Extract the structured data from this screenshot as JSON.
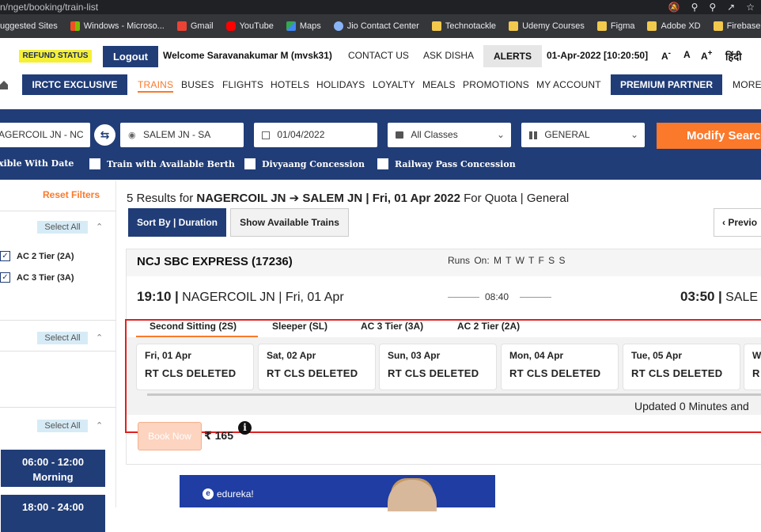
{
  "browser": {
    "url": "n/nget/booking/train-list",
    "bookmarks": [
      "uggested Sites",
      "Windows - Microso...",
      "Gmail",
      "YouTube",
      "Maps",
      "Jio Contact Center",
      "Technotackle",
      "Udemy Courses",
      "Figma",
      "Adobe XD",
      "Firebase"
    ]
  },
  "header": {
    "refund_status": "REFUND STATUS",
    "logout": "Logout",
    "welcome": "Welcome Saravanakumar M (mvsk31)",
    "contact_us": "CONTACT US",
    "ask_disha": "ASK DISHA",
    "alerts": "ALERTS",
    "datetime": "01-Apr-2022 [10:20:50]",
    "font_small": "A",
    "font_normal": "A",
    "font_large": "A",
    "font_small_sign": "-",
    "font_large_sign": "+",
    "hindi": "हिंदी"
  },
  "nav": {
    "irctc_exclusive": "IRCTC EXCLUSIVE",
    "links": [
      "TRAINS",
      "BUSES",
      "FLIGHTS",
      "HOTELS",
      "HOLIDAYS",
      "LOYALTY",
      "MEALS",
      "PROMOTIONS",
      "MY ACCOUNT"
    ],
    "premium_partner": "PREMIUM PARTNER",
    "more": "MORE"
  },
  "search": {
    "from": "AGERCOIL JN - NC",
    "to": "SALEM JN - SA",
    "date": "01/04/2022",
    "class": "All Classes",
    "quota": "GENERAL",
    "modify": "Modify Search",
    "options": [
      "xible With Date",
      "Train with Available Berth",
      "Divyaang Concession",
      "Railway Pass Concession"
    ]
  },
  "filters": {
    "reset": "Reset Filters",
    "select_all": "Select All",
    "classes": [
      "AC 2 Tier (2A)",
      "AC 3 Tier (3A)"
    ],
    "time_slots": [
      {
        "time": "06:00 - 12:00",
        "label": "Morning"
      },
      {
        "time": "18:00 - 24:00",
        "label": ""
      }
    ]
  },
  "results": {
    "count_text": "5 Results for",
    "from": "NAGERCOIL JN",
    "arrow": "➔",
    "to": "SALEM JN",
    "date_text": "| Fri, 01 Apr 2022",
    "quota_text": "For Quota | General",
    "sort_by": "Sort By | Duration",
    "show_available": "Show Available Trains",
    "previous": "Previo"
  },
  "train": {
    "name": "NCJ SBC EXPRESS (17236)",
    "runs_on_label": "Runs On:",
    "runs_on_days": "M T W T F S S",
    "dep_time": "19:10",
    "dep_station": "NAGERCOIL JN | Fri, 01 Apr",
    "duration": "08:40",
    "arr_time": "03:50",
    "arr_station": "SALE",
    "classes": [
      "Second Sitting (2S)",
      "Sleeper (SL)",
      "AC 3 Tier (3A)",
      "AC 2 Tier (2A)"
    ],
    "availability": [
      {
        "date": "Fri, 01 Apr",
        "status": "RT CLS DELETED"
      },
      {
        "date": "Sat, 02 Apr",
        "status": "RT CLS DELETED"
      },
      {
        "date": "Sun, 03 Apr",
        "status": "RT CLS DELETED"
      },
      {
        "date": "Mon, 04 Apr",
        "status": "RT CLS DELETED"
      },
      {
        "date": "Tue, 05 Apr",
        "status": "RT CLS DELETED"
      },
      {
        "date": "W",
        "status": "R"
      }
    ],
    "updated": "Updated 0 Minutes and",
    "book_now": "Book Now",
    "fare": "₹ 165",
    "info": "i"
  },
  "ad": {
    "brand": "edureka!"
  }
}
